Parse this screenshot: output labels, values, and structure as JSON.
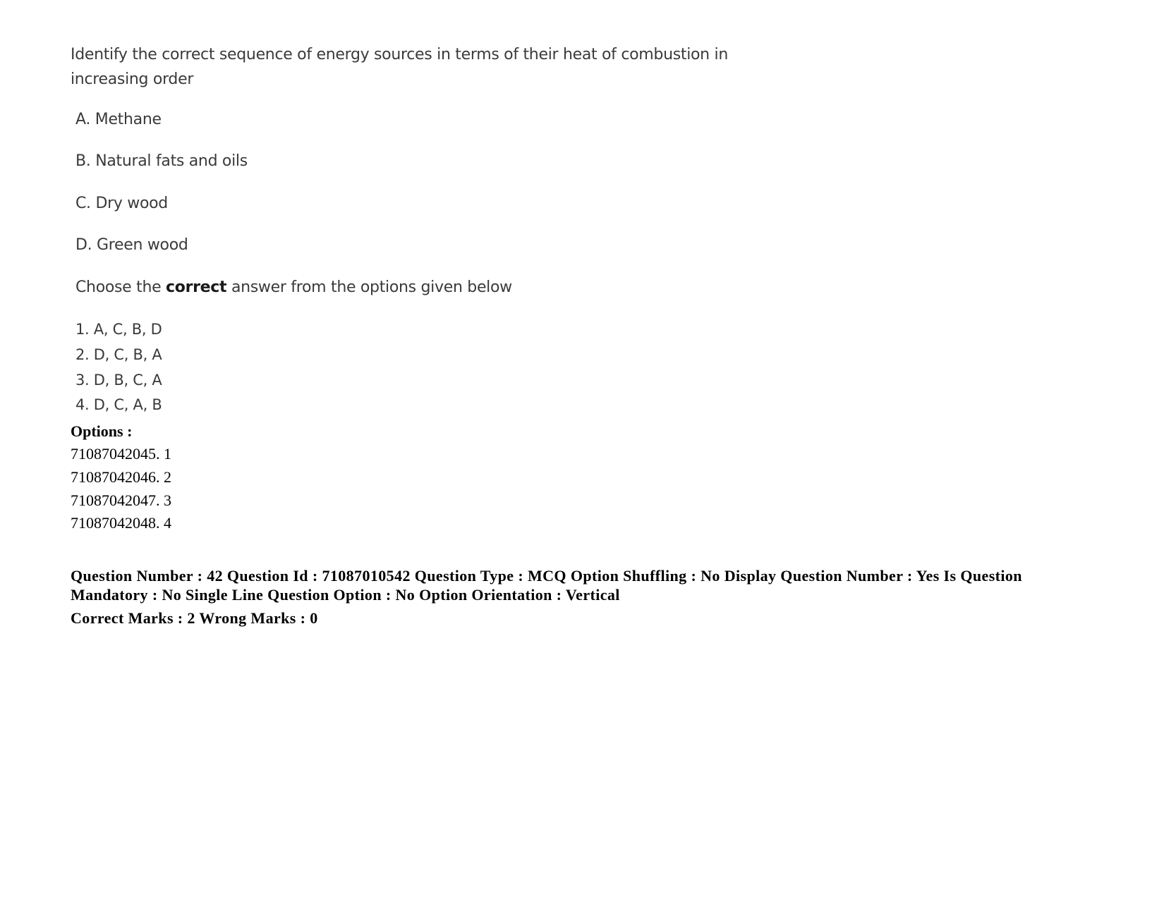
{
  "question": {
    "stem": "Identify the correct sequence of energy sources in terms of their heat of combustion in increasing order",
    "statements": [
      {
        "label": "A.",
        "text": "Methane"
      },
      {
        "label": "B.",
        "text": "Natural fats and oils"
      },
      {
        "label": "C.",
        "text": "Dry wood"
      },
      {
        "label": "D.",
        "text": "Green wood"
      }
    ],
    "instruction": {
      "prefix": "Choose the ",
      "emphasis": "correct",
      "suffix": " answer from the options given below"
    },
    "choices": [
      "1. A, C, B, D",
      "2. D, C, B, A",
      "3. D, B, C, A",
      "4. D, C, A, B"
    ]
  },
  "options": {
    "heading": "Options :",
    "items": [
      "71087042045. 1",
      "71087042046. 2",
      "71087042047. 3",
      "71087042048. 4"
    ]
  },
  "metadata": {
    "details": "Question Number : 42 Question Id : 71087010542 Question Type : MCQ Option Shuffling : No Display Question Number : Yes Is Question Mandatory : No Single Line Question Option : No Option Orientation : Vertical",
    "marks": "Correct Marks : 2 Wrong Marks : 0"
  }
}
